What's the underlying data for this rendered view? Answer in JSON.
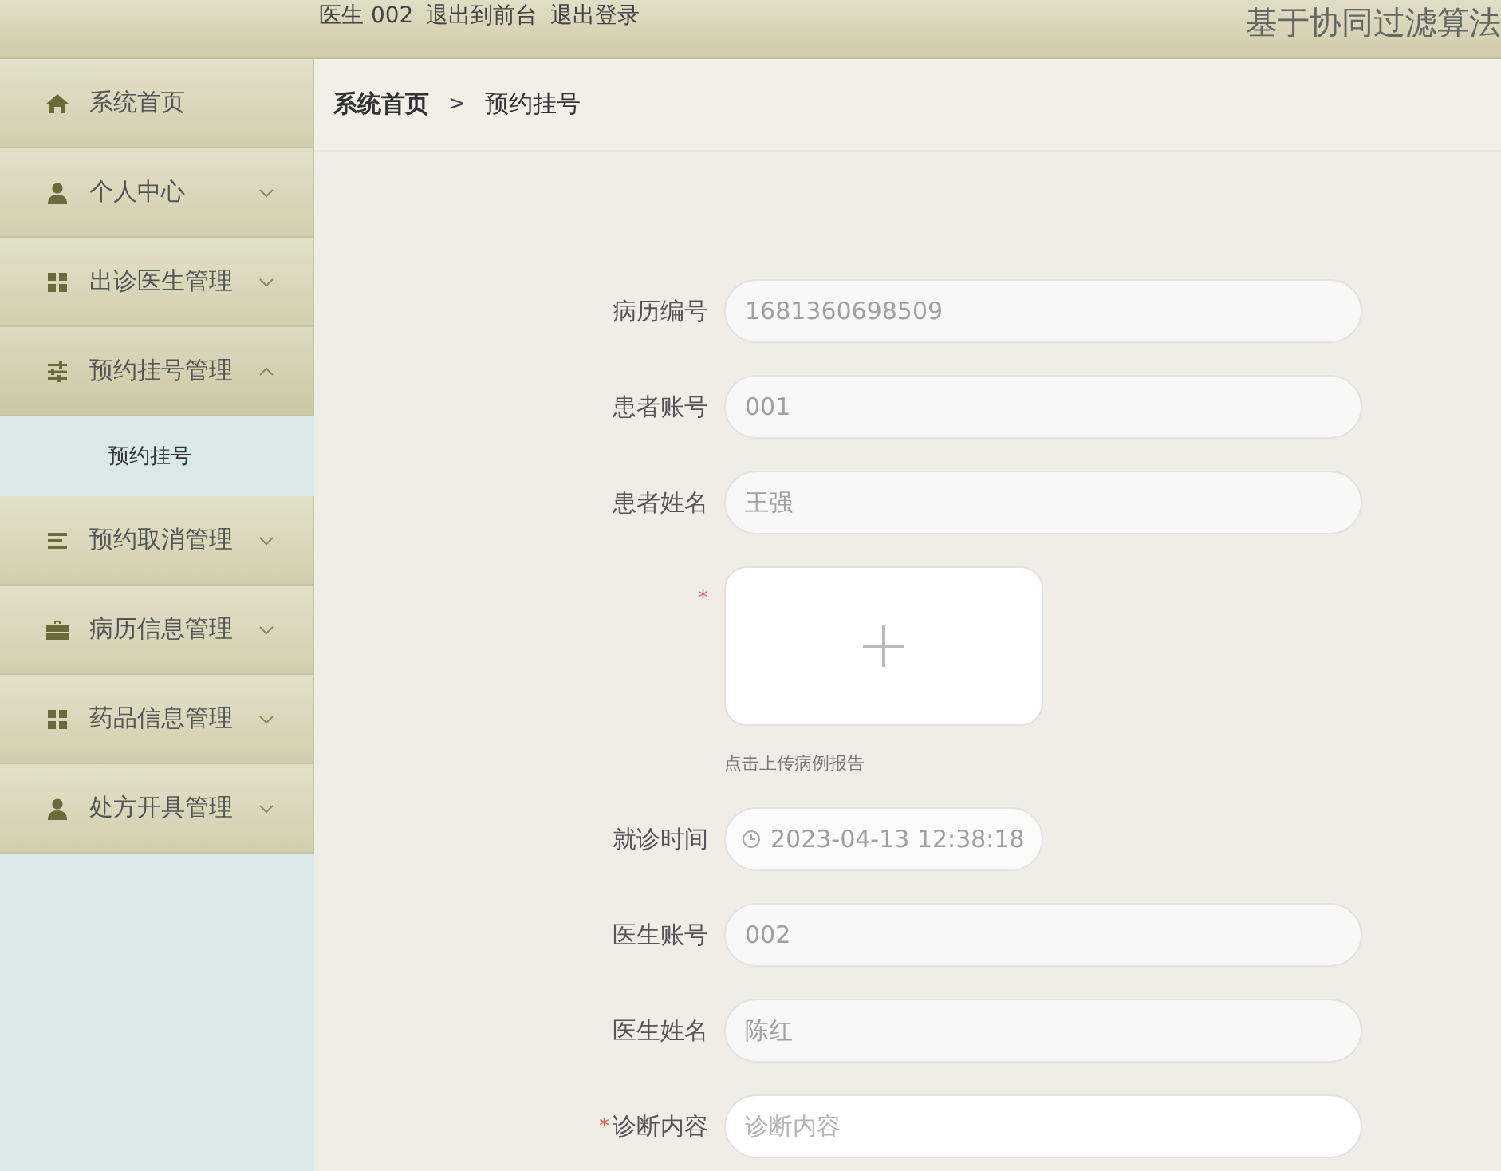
{
  "header": {
    "user_links": [
      "医生 002",
      "退出到前台",
      "退出登录"
    ],
    "title": "基于协同过滤算法"
  },
  "sidebar": {
    "items": [
      {
        "label": "系统首页",
        "kind": "home"
      },
      {
        "label": "个人中心",
        "kind": "user",
        "expanded": false
      },
      {
        "label": "出诊医生管理",
        "kind": "grid",
        "expanded": false
      },
      {
        "label": "预约挂号管理",
        "kind": "sliders",
        "expanded": true,
        "children": [
          {
            "label": "预约挂号",
            "selected": true
          }
        ]
      },
      {
        "label": "预约取消管理",
        "kind": "list",
        "expanded": false
      },
      {
        "label": "病历信息管理",
        "kind": "briefcase",
        "expanded": false
      },
      {
        "label": "药品信息管理",
        "kind": "grid",
        "expanded": false
      },
      {
        "label": "处方开具管理",
        "kind": "user",
        "expanded": false
      }
    ]
  },
  "breadcrumb": {
    "items": [
      "系统首页",
      "预约挂号"
    ],
    "separator": ">"
  },
  "form": {
    "fields": [
      {
        "kind": "text",
        "label": "病历编号",
        "value": "1681360698509",
        "disabled": true
      },
      {
        "kind": "text",
        "label": "患者账号",
        "value": "001",
        "disabled": true
      },
      {
        "kind": "text",
        "label": "患者姓名",
        "value": "王强",
        "disabled": true
      },
      {
        "kind": "upload",
        "required_mark": "*",
        "hint": "点击上传病例报告"
      },
      {
        "kind": "datetime",
        "label": "就诊时间",
        "value": "2023-04-13 12:38:18",
        "disabled": true
      },
      {
        "kind": "text",
        "label": "医生账号",
        "value": "002",
        "disabled": true
      },
      {
        "kind": "text",
        "label": "医生姓名",
        "value": "陈红",
        "disabled": true
      },
      {
        "kind": "text",
        "required_mark": "*",
        "label": "诊断内容",
        "placeholder": "诊断内容",
        "disabled": false
      }
    ]
  }
}
